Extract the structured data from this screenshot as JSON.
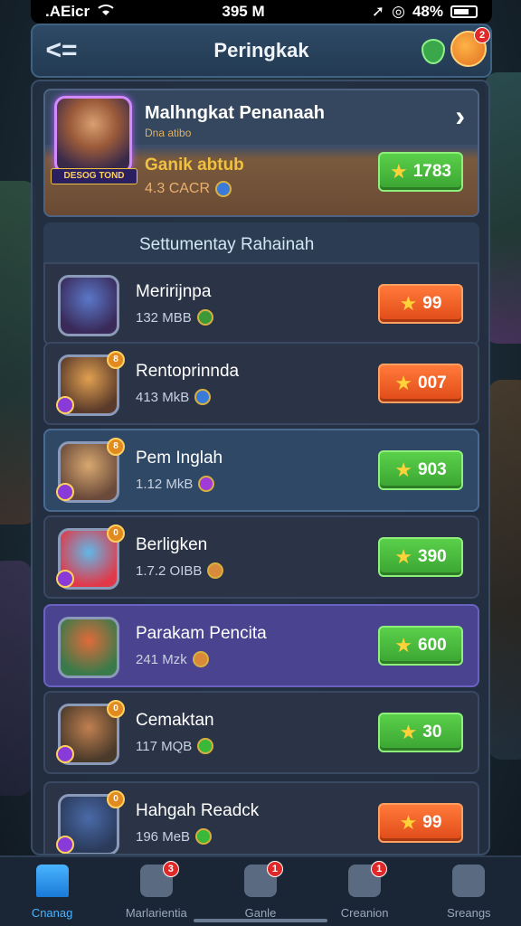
{
  "status_bar": {
    "carrier": ".AEicr",
    "time": "395 M",
    "battery": "48%"
  },
  "header": {
    "back_label": "<=",
    "title": "Peringkak",
    "profile_badge_count": "2"
  },
  "featured": {
    "title": "Malhngkat Penanaah",
    "subtitle": "Dna atibo",
    "avatar_tag": "DESOG TOND",
    "name": "Ganik abtub",
    "size": "4.3 CACR",
    "score": "1783",
    "score_color": "green"
  },
  "section_title": "Settumentay Rahainah",
  "rows": [
    {
      "name": "Meririjnpa",
      "size": "132 MBB",
      "score": "99",
      "score_color": "orange",
      "style": "normal",
      "avatar_colors": [
        "#5a78c8",
        "#3a2a5a"
      ],
      "badge": ""
    },
    {
      "name": "Rentoprinnda",
      "size": "413 MkB",
      "score": "007",
      "score_color": "orange",
      "style": "normal",
      "avatar_colors": [
        "#e0a050",
        "#5a3a2a"
      ],
      "badge": "8"
    },
    {
      "name": "Pem Inglah",
      "size": "1.12 MkB",
      "score": "903",
      "score_color": "green",
      "style": "highlight",
      "avatar_colors": [
        "#d8a870",
        "#6a4a3a"
      ],
      "badge": "8"
    },
    {
      "name": "Berligken",
      "size": "1.7.2 OIBB",
      "score": "390",
      "score_color": "green",
      "style": "normal",
      "avatar_colors": [
        "#60b8e8",
        "#e03a4a"
      ],
      "badge": "0"
    },
    {
      "name": "Parakam Pencita",
      "size": "241 Mzk",
      "score": "600",
      "score_color": "green",
      "style": "purple",
      "avatar_colors": [
        "#e06a3a",
        "#3a7a4a"
      ],
      "badge": ""
    },
    {
      "name": "Cemaktan",
      "size": "117 MQB",
      "score": "30",
      "score_color": "green",
      "style": "normal",
      "avatar_colors": [
        "#c08050",
        "#4a3a2a"
      ],
      "badge": "0"
    },
    {
      "name": "Hahgah Readck",
      "size": "196 MeB",
      "score": "99",
      "score_color": "orange",
      "style": "normal",
      "avatar_colors": [
        "#4a6aa8",
        "#2a3a5a"
      ],
      "badge": "0"
    }
  ],
  "bottom_nav": [
    {
      "label": "Cnanag",
      "icon": "home-icon",
      "active": true,
      "badge": ""
    },
    {
      "label": "Marlarientia",
      "icon": "profile-icon",
      "active": false,
      "badge": "3"
    },
    {
      "label": "Ganle",
      "icon": "envelope-icon",
      "active": false,
      "badge": "1"
    },
    {
      "label": "Creanion",
      "icon": "gamepad-icon",
      "active": false,
      "badge": "1"
    },
    {
      "label": "Sreangs",
      "icon": "user-icon",
      "active": false,
      "badge": ""
    }
  ],
  "colors": {
    "green": "#3aa432",
    "orange": "#e04a18",
    "accent": "#4ab4ff"
  }
}
